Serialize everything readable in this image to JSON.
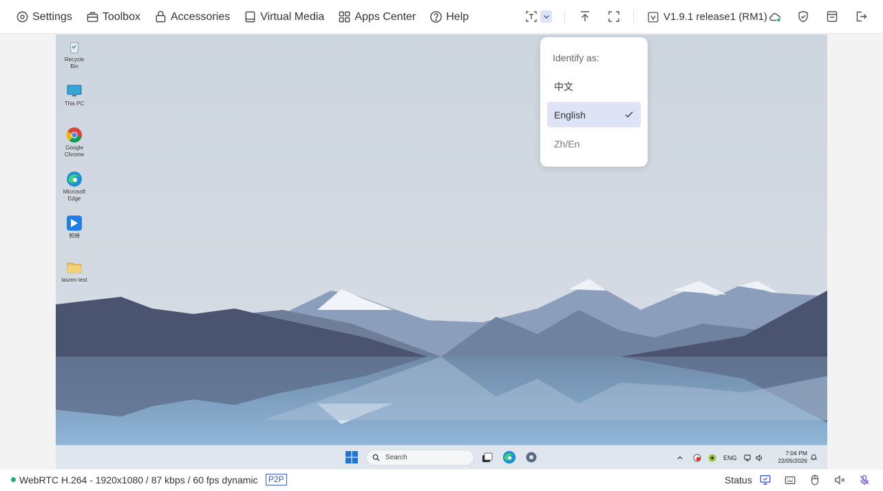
{
  "nav": {
    "settings": "Settings",
    "toolbox": "Toolbox",
    "accessories": "Accessories",
    "virtual_media": "Virtual Media",
    "apps_center": "Apps Center",
    "help": "Help"
  },
  "toolbar": {
    "version": "V1.9.1 release1 (RM1)"
  },
  "dropdown": {
    "title": "Identify as:",
    "options": [
      "中文",
      "English",
      "Zh/En"
    ],
    "selected": "English"
  },
  "desktop": {
    "icons": [
      "Recycle Bin",
      "This PC",
      "Google Chrome",
      "Microsoft Edge",
      "剪映",
      "lauren test"
    ],
    "taskbar": {
      "search_placeholder": "Search",
      "language": "ENG",
      "time": "7:04 PM",
      "date": "22/05/2026"
    }
  },
  "status": {
    "connection": "WebRTC H.264 - 1920x1080 /  87 kbps / 60 fps dynamic",
    "mode": "P2P",
    "label": "Status"
  },
  "colors": {
    "accent": "#3b5bdb",
    "connected": "#1aaa73",
    "selected_bg": "#dfe3f6"
  }
}
